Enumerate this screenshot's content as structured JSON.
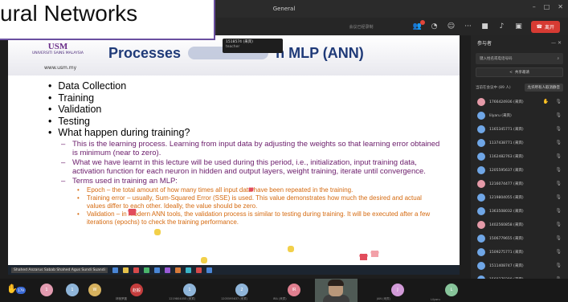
{
  "window": {
    "title": "General"
  },
  "toolbar": {
    "recording_text": "会议已经录制",
    "leave_label": "离开"
  },
  "banner": {
    "text": "ural Networks"
  },
  "slide": {
    "logo_text": "USM",
    "university": "UNIVERSITI SAINS MALAYSIA",
    "url": "www.usm.my",
    "title_prefix": "Processes",
    "title_suffix": "n MLP (ANN)",
    "bullets": [
      "Data Collection",
      "Training",
      "Validation",
      "Testing",
      "What happen during training?"
    ],
    "dashes": [
      "This is the learning process. Learning from input data by adjusting the weights so that learning error obtained is minimum (near to zero).",
      "What we have learnt in this lecture will be used during this period, i.e., initialization, input training data, activation function for each neuron in hidden and output layers, weight training, iterate until convergence.",
      "Terms used in training an MLP:"
    ],
    "subs": [
      "Epoch – the total amount of how many times all input data have been repeated in the training.",
      "Training error – usually, Sum-Squared Error (SSE) is used. This value demonstrates how much the desired and actual values differ to each other. Ideally, the value should be zero.",
      "Validation – in modern ANN tools, the validation process is similar to testing during training. It will be executed after a few iterations (epochs) to check the training performance."
    ]
  },
  "name_popup": {
    "line1": "1518574 (来宾)",
    "line2": "teacher"
  },
  "presenter": {
    "label": "Shahed Anzarus Sabab Shahed Agus Sundi Suandi"
  },
  "panel": {
    "title": "参与者",
    "search_placeholder": "键入姓名或电话号码",
    "invite_label": "共享邀请",
    "section_label": "当前在会议中 (89 人)",
    "section_button": "允许所有人取消静音",
    "participants": [
      {
        "name": "1766424936 (来宾)",
        "hand": true
      },
      {
        "name": "lilyaru (来宾)",
        "hand": false
      },
      {
        "name": "1165345771 (来宾)",
        "hand": false
      },
      {
        "name": "1137438771 (来宾)",
        "hand": false
      },
      {
        "name": "1162482763 (来宾)",
        "hand": false
      },
      {
        "name": "1205595637 (来宾)",
        "hand": false
      },
      {
        "name": "1216074477 (来宾)",
        "hand": false
      },
      {
        "name": "1219804055 (来宾)",
        "hand": false
      },
      {
        "name": "1363508032 (来宾)",
        "hand": false
      },
      {
        "name": "1402560858 (来宾)",
        "hand": false
      },
      {
        "name": "1506779655 (来宾)",
        "hand": false
      },
      {
        "name": "1509275771 (来宾)",
        "hand": false
      },
      {
        "name": "1511408747 (来宾)",
        "hand": false
      },
      {
        "name": "1569379290 (来宾)",
        "hand": false
      }
    ]
  },
  "strip": {
    "hand_count": "179",
    "tiles": [
      {
        "initial": "1",
        "color": "#e39bb0",
        "name": ""
      },
      {
        "initial": "1",
        "color": "#8fb5d9",
        "name": ""
      },
      {
        "initial": "W",
        "color": "#d6b15e",
        "name": ""
      },
      {
        "initial": "赵毅",
        "color": "#c43d3d",
        "name": "林驰罗晨"
      },
      {
        "initial": "1",
        "color": "#8fb5d9",
        "name": "1219804055 (来宾)"
      },
      {
        "initial": "2",
        "color": "#8fb5d9",
        "name": "1205595637 (来宾)"
      },
      {
        "initial": "IR",
        "color": "#e07f8f",
        "name": "IRA (来宾)"
      },
      {
        "initial": "J",
        "color": "#d29ad8",
        "name": "JAN (来宾)"
      },
      {
        "initial": "L",
        "color": "#87c49a",
        "name": "Lilyaru"
      }
    ]
  }
}
